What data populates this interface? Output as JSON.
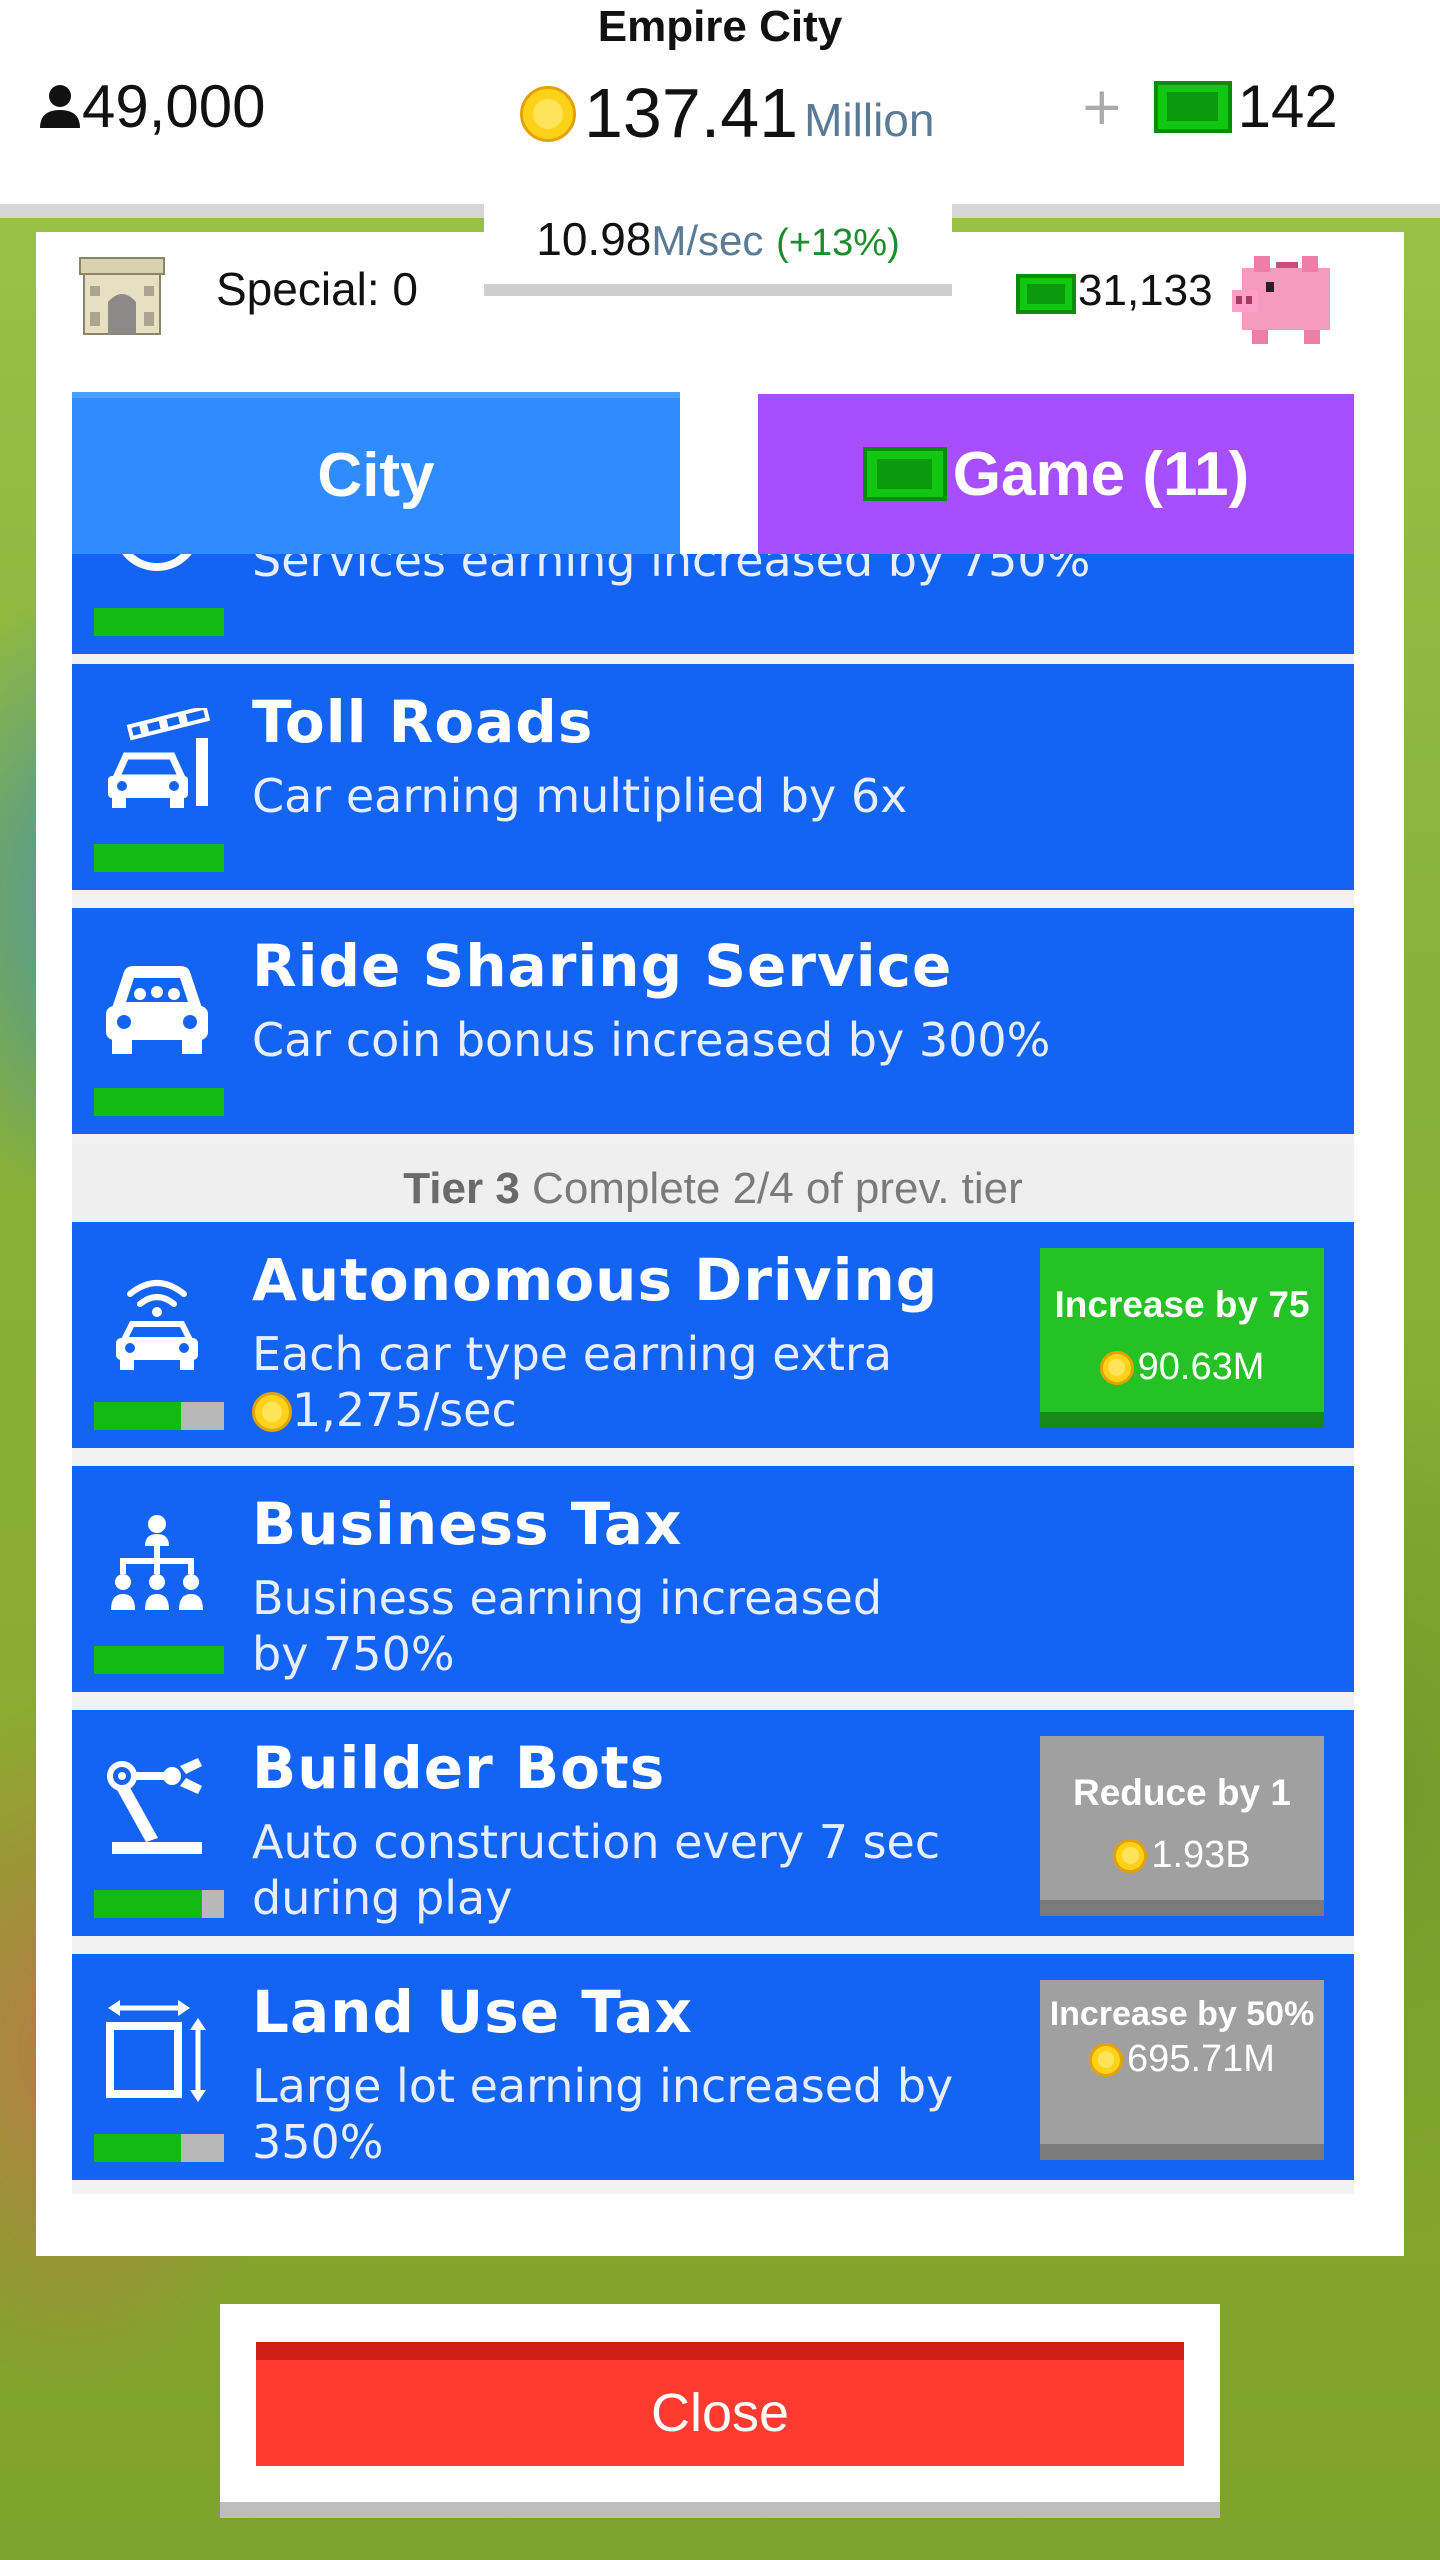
{
  "header": {
    "city_name": "Empire City",
    "population": "49,000",
    "coins_amount": "137.41",
    "coins_unit": "Million",
    "plus": "+",
    "cash": "142"
  },
  "rate": {
    "value": "10.98",
    "unit": "M/sec",
    "bonus": "(+13%)"
  },
  "special": {
    "label": "Special: 0"
  },
  "bank": {
    "cash": "31,133"
  },
  "tabs": {
    "city": "City",
    "game": "Game (11)"
  },
  "upgrades": [
    {
      "title": "",
      "desc": "Services earning increased by 750%",
      "progress": 1.0
    },
    {
      "title": "Toll Roads",
      "desc": "Car earning multiplied by 6x",
      "progress": 1.0
    },
    {
      "title": "Ride Sharing Service",
      "desc": "Car coin bonus increased by 300%",
      "progress": 1.0
    },
    {
      "title": "Autonomous Driving",
      "desc": "Each car type earning extra",
      "desc2": "1,275/sec",
      "progress": 0.67,
      "action": {
        "line1": "Increase by 75",
        "cost": "90.63M",
        "color": "#24c224"
      }
    },
    {
      "title": "Business Tax",
      "desc": "Business earning increased by 750%",
      "progress": 1.0
    },
    {
      "title": "Builder Bots",
      "desc": "Auto construction every 7 sec during play",
      "progress": 0.83,
      "action": {
        "line1": "Reduce by 1",
        "cost": "1.93B",
        "color": "#a0a0a0"
      }
    },
    {
      "title": "Land Use Tax",
      "desc": "Large lot earning increased by 350%",
      "progress": 0.67,
      "action": {
        "line1": "Increase by 50%",
        "cost": "695.71M",
        "color": "#a0a0a0"
      }
    }
  ],
  "tier": {
    "label": "Tier 3",
    "text": "Complete 2/4 of prev. tier"
  },
  "close_label": "Close"
}
